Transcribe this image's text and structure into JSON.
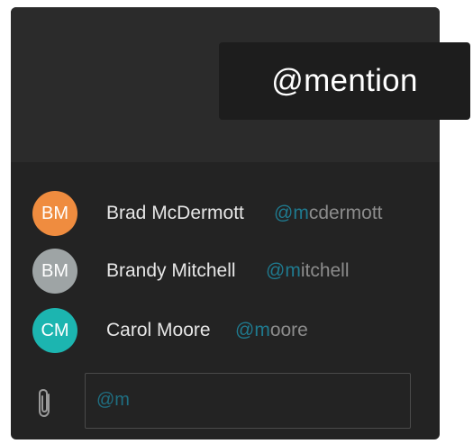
{
  "callout": {
    "label": "@mention"
  },
  "suggestions": [
    {
      "initials": "BM",
      "avatar_color": "#ef8c3f",
      "name": "Brad McDermott",
      "handle_typed": "@m",
      "handle_rest": "cdermott"
    },
    {
      "initials": "BM",
      "avatar_color": "#9ea4a5",
      "name": "Brandy Mitchell",
      "handle_typed": "@m",
      "handle_rest": "itchell"
    },
    {
      "initials": "CM",
      "avatar_color": "#1cb5b0",
      "name": "Carol Moore",
      "handle_typed": "@m",
      "handle_rest": "oore"
    }
  ],
  "composer": {
    "attach_icon": "paperclip-icon",
    "input_value": "@m"
  },
  "colors": {
    "panel": "#232323",
    "mention_typed": "#1f7a8f",
    "handle_rest": "#8c8c8c"
  }
}
